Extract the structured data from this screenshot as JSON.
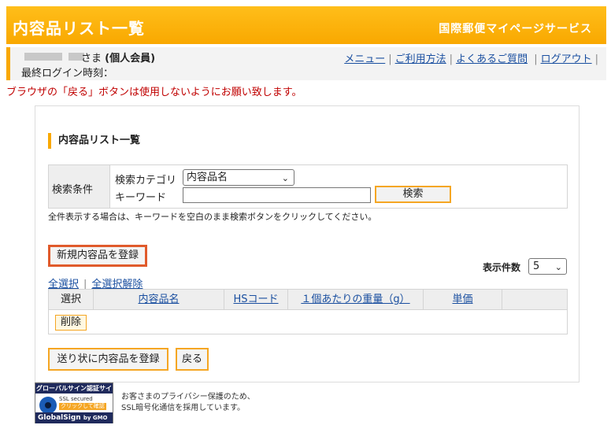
{
  "header": {
    "title": "内容品リスト一覧",
    "service": "国際郵便マイページサービス"
  },
  "user": {
    "sama": "さま",
    "member_type": "(個人会員)",
    "last_login": "最終ログイン時刻："
  },
  "top_links": [
    "メニュー",
    "ご利用方法",
    "よくあるご質問",
    "ログアウト"
  ],
  "warning": "ブラウザの「戻る」ボタンは使用しないようにお願い致します。",
  "section_title": "内容品リスト一覧",
  "search": {
    "label": "検索条件",
    "category_label": "検索カテゴリ",
    "category_value": "内容品名",
    "keyword_label": "キーワード",
    "keyword_value": "",
    "button": "検索",
    "hint": "全件表示する場合は、キーワードを空白のまま検索ボタンをクリックしてください。"
  },
  "new_button": "新規内容品を登録",
  "count": {
    "label": "表示件数",
    "value": "5"
  },
  "select_all": "全選択",
  "deselect_all": "全選択解除",
  "table": {
    "columns": [
      "選択",
      "内容品名",
      "HSコード",
      "１個あたりの重量（g）",
      "単価"
    ],
    "delete_button": "削除"
  },
  "bottom_buttons": {
    "register_to_label": "送り状に内容品を登録",
    "back": "戻る"
  },
  "globalsign": {
    "top": "グローバルサイン認証サイト",
    "ssl": "SSL secured",
    "click": "クリックして確認",
    "brand": "GlobalSign",
    "by": "by GMO"
  },
  "privacy_note": [
    "お客さまのプライバシー保護のため、",
    "SSL暗号化通信を採用しています。"
  ],
  "colors": {
    "header_orange": "#f9a800",
    "link_blue": "#1a4fa0",
    "warning_red": "#c00000",
    "highlight_red": "#e05a2b"
  }
}
